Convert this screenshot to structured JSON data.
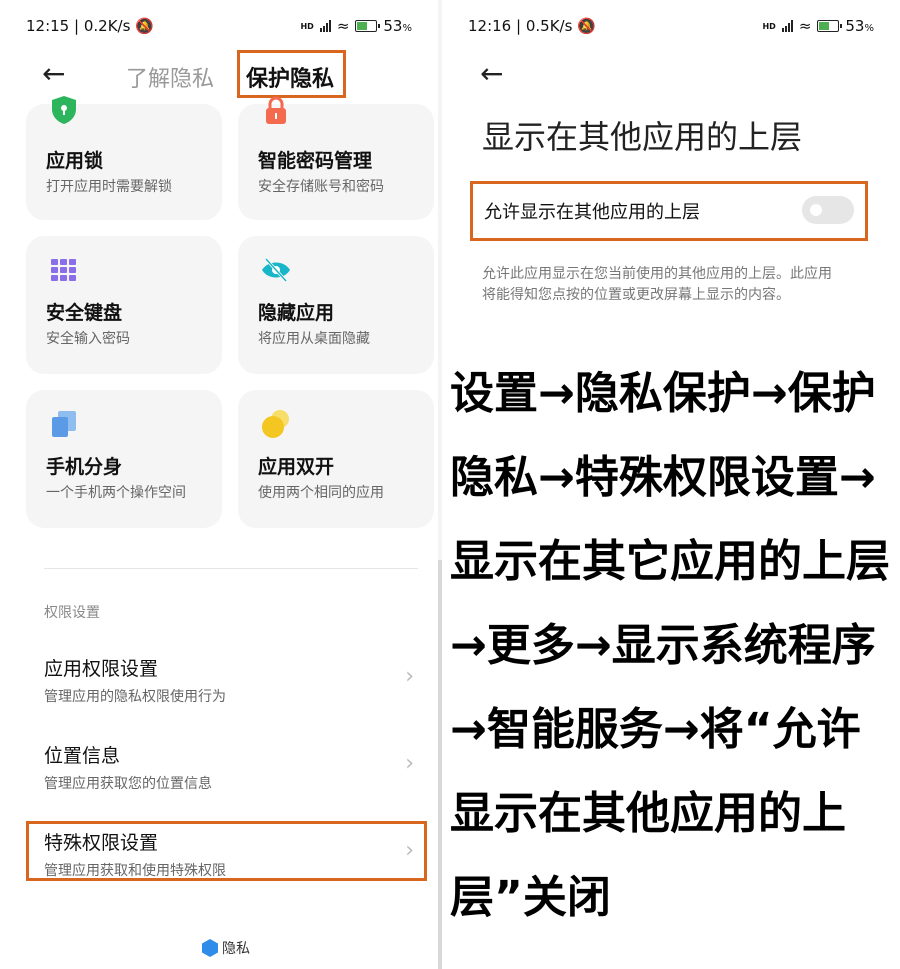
{
  "left": {
    "status": {
      "time": "12:15",
      "speed": "0.2K/s",
      "battery": "53",
      "net": "HD"
    },
    "tabs": {
      "inactive": "了解隐私",
      "active": "保护隐私"
    },
    "cards": [
      {
        "title": "应用锁",
        "subtitle": "打开应用时需要解锁",
        "icon": "shield-lock-icon"
      },
      {
        "title": "智能密码管理",
        "subtitle": "安全存储账号和密码",
        "icon": "padlock-icon"
      },
      {
        "title": "安全键盘",
        "subtitle": "安全输入密码",
        "icon": "keyboard-grid-icon"
      },
      {
        "title": "隐藏应用",
        "subtitle": "将应用从桌面隐藏",
        "icon": "eye-off-icon"
      },
      {
        "title": "手机分身",
        "subtitle": "一个手机两个操作空间",
        "icon": "clone-icon"
      },
      {
        "title": "应用双开",
        "subtitle": "使用两个相同的应用",
        "icon": "dual-circle-icon"
      }
    ],
    "section_label": "权限设置",
    "rows": [
      {
        "title": "应用权限设置",
        "subtitle": "管理应用的隐私权限使用行为"
      },
      {
        "title": "位置信息",
        "subtitle": "管理应用获取您的位置信息"
      },
      {
        "title": "特殊权限设置",
        "subtitle": "管理应用获取和使用特殊权限"
      }
    ],
    "brand": "隐私"
  },
  "right": {
    "status": {
      "time": "12:16",
      "speed": "0.5K/s",
      "battery": "53",
      "net": "HD"
    },
    "page_title": "显示在其他应用的上层",
    "toggle": {
      "label": "允许显示在其他应用的上层",
      "state": "off"
    },
    "description": "允许此应用显示在您当前使用的其他应用的上层。此应用将能得知您点按的位置或更改屏幕上显示的内容。",
    "instructions": "设置→隐私保护→保护隐私→特殊权限设置→显示在其它应用的上层→更多→显示系统程序→智能服务→将“允许显示在其他应用的上层”关闭"
  },
  "colors": {
    "highlight": "#d9661e",
    "green": "#2db55d",
    "orange": "#f46a4e",
    "purple": "#8a6de9",
    "teal": "#19b6c9",
    "blue": "#5b9be6",
    "yellow": "#f3c621"
  }
}
